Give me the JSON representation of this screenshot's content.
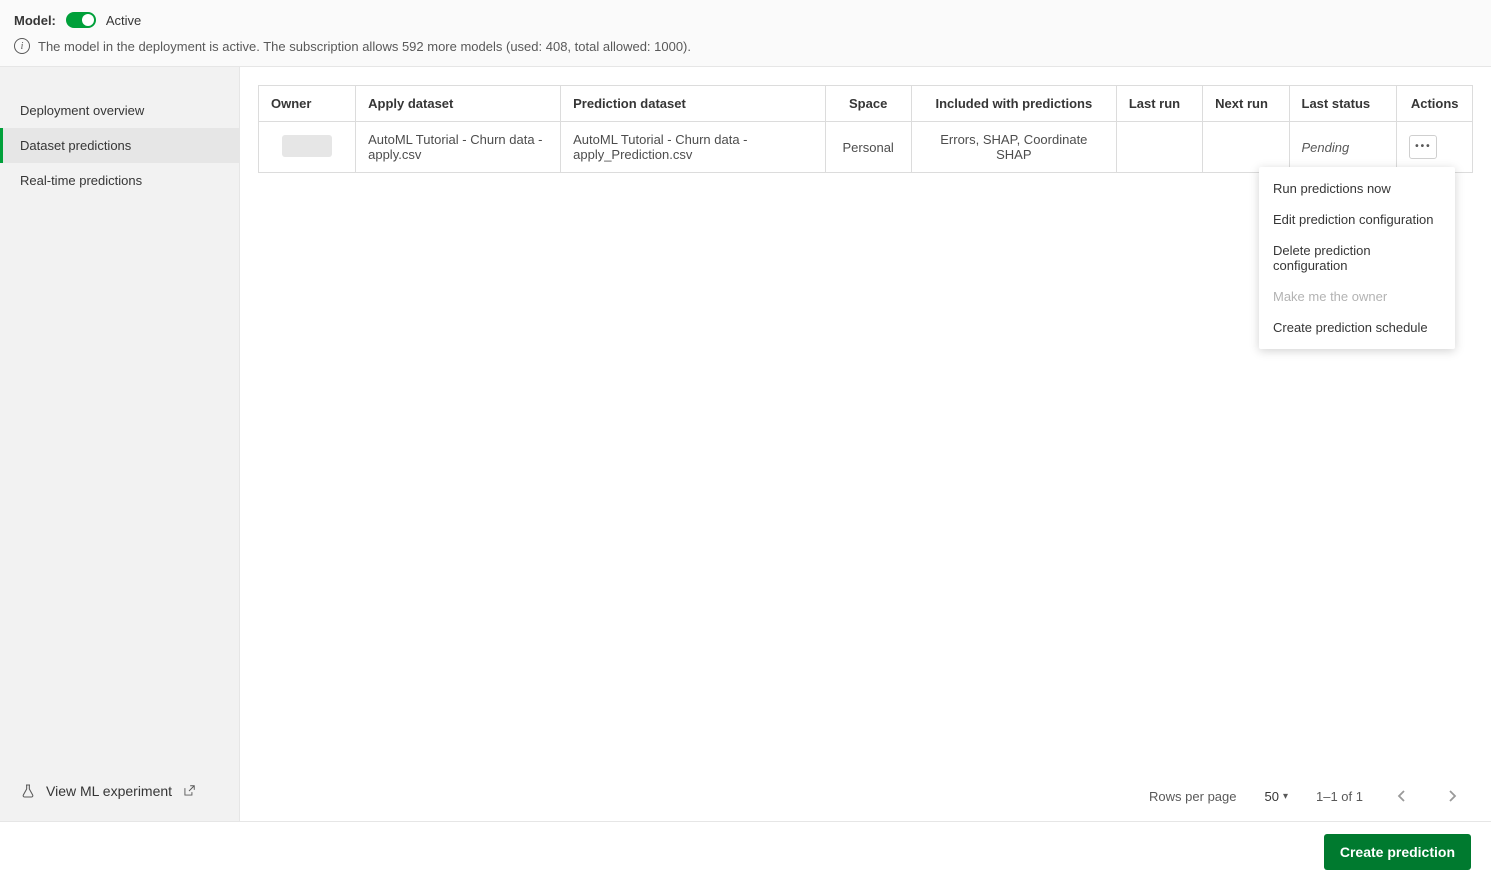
{
  "header": {
    "model_label": "Model:",
    "active_label": "Active",
    "info_text": "The model in the deployment is active. The subscription allows 592 more models (used: 408, total allowed: 1000)."
  },
  "sidebar": {
    "items": [
      {
        "label": "Deployment overview"
      },
      {
        "label": "Dataset predictions"
      },
      {
        "label": "Real-time predictions"
      }
    ],
    "footer_label": "View ML experiment"
  },
  "table": {
    "columns": {
      "owner": "Owner",
      "apply": "Apply dataset",
      "prediction": "Prediction dataset",
      "space": "Space",
      "included": "Included with predictions",
      "last_run": "Last run",
      "next_run": "Next run",
      "last_status": "Last status",
      "actions": "Actions"
    },
    "rows": [
      {
        "apply": "AutoML Tutorial - Churn data - apply.csv",
        "prediction": "AutoML Tutorial - Churn data - apply_Prediction.csv",
        "space": "Personal",
        "included": "Errors, SHAP, Coordinate SHAP",
        "last_run": "",
        "next_run": "",
        "last_status": "Pending"
      }
    ]
  },
  "dropdown": {
    "run_now": "Run predictions now",
    "edit": "Edit prediction configuration",
    "delete": "Delete prediction configuration",
    "make_owner": "Make me the owner",
    "schedule": "Create prediction schedule"
  },
  "pager": {
    "rows_per_page_label": "Rows per page",
    "rows_per_page_value": "50",
    "range": "1–1 of 1"
  },
  "footer": {
    "create_label": "Create prediction"
  }
}
